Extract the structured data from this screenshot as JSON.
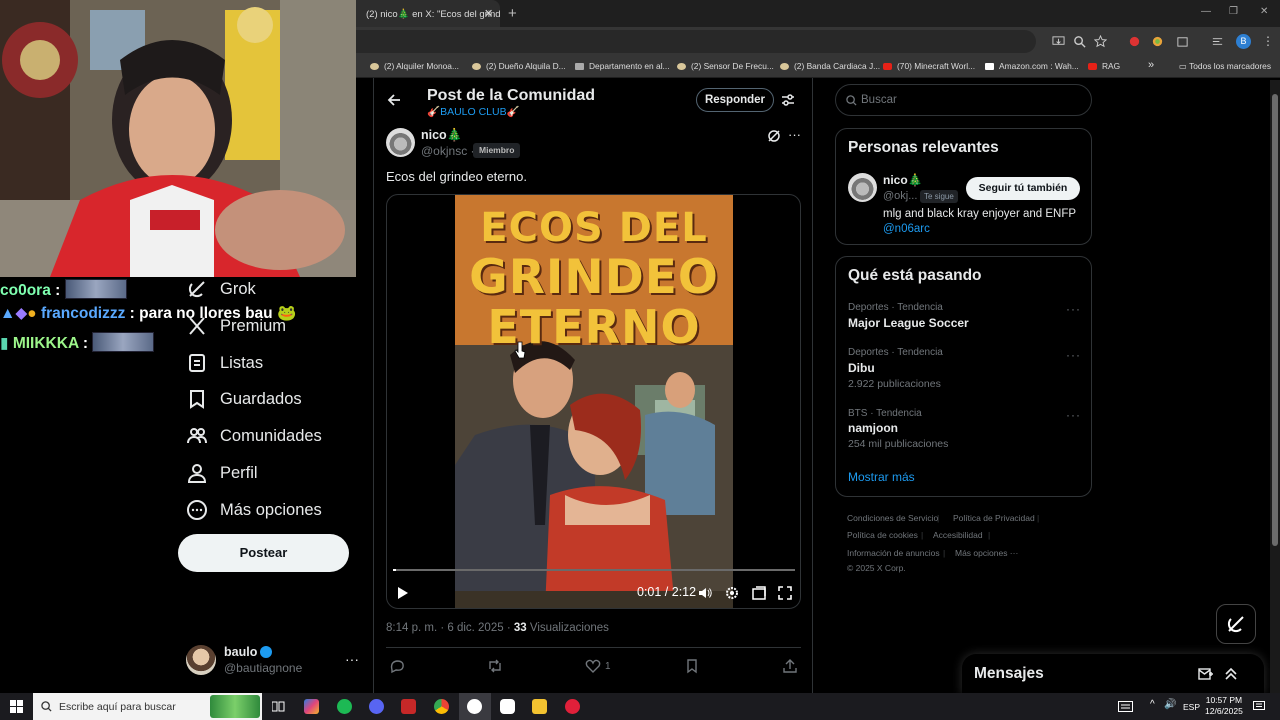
{
  "browser": {
    "tab_title": "(2) nico🎄 en X: \"Ecos del grind",
    "bookmarks": [
      {
        "label": "(2) Alquiler Monoa...",
        "icon": "olx-icon"
      },
      {
        "label": "(2) Dueño Alquila D...",
        "icon": "olx-icon"
      },
      {
        "label": "Departamento en al...",
        "icon": "page-icon"
      },
      {
        "label": "(2) Sensor De Frecu...",
        "icon": "olx-icon"
      },
      {
        "label": "(2) Banda Cardiaca J...",
        "icon": "olx-icon"
      },
      {
        "label": "(70) Minecraft Worl...",
        "icon": "youtube-icon"
      },
      {
        "label": "Amazon.com : Wah...",
        "icon": "amazon-icon"
      },
      {
        "label": "RAG",
        "icon": "youtube-icon"
      }
    ],
    "bookmarks_folder": "Todos los marcadores",
    "profile_initial": "B"
  },
  "stream_chat": [
    {
      "user": "co0ora",
      "text": ":"
    },
    {
      "user": "francodizzz",
      "text": ": para no llores bau"
    },
    {
      "user": "MIIKKKA",
      "text": ":"
    }
  ],
  "nav": {
    "items": [
      {
        "label": "Grok",
        "icon": "grok-icon"
      },
      {
        "label": "Premium",
        "icon": "x-logo-icon"
      },
      {
        "label": "Listas",
        "icon": "list-icon"
      },
      {
        "label": "Guardados",
        "icon": "bookmark-icon"
      },
      {
        "label": "Comunidades",
        "icon": "communities-icon"
      },
      {
        "label": "Perfil",
        "icon": "profile-icon"
      },
      {
        "label": "Más opciones",
        "icon": "more-circle-icon"
      }
    ],
    "post_button": "Postear",
    "account": {
      "name": "baulo",
      "handle": "@bautiagnone"
    }
  },
  "post": {
    "header_title": "Post de la Comunidad",
    "community": "🎸BAULO CLUB🎸",
    "reply_button": "Responder",
    "author_name": "nico🎄",
    "author_handle": "@okjnsc ·",
    "member_badge": "Miembro",
    "text": "Ecos del grindeo eterno.",
    "poster_title_lines": [
      "ECOS DEL",
      "GRINDEO",
      "ETERNO"
    ],
    "video_time": "0:01 / 2:12",
    "video_progress": 0.008,
    "timestamp": "8:14 p. m. · 6 dic. 2025 ·",
    "views_count": "33",
    "views_label": "Visualizaciones",
    "like_count": "1"
  },
  "sidebar": {
    "search_placeholder": "Buscar",
    "relevant_title": "Personas relevantes",
    "relevant_person": {
      "name": "nico🎄",
      "handle": "@okj...",
      "follows_you": "Te sigue",
      "follow_button": "Seguir tú también",
      "bio": "mlg and black kray enjoyer and ENFP",
      "bio_link": "@n06arc"
    },
    "trends_title": "Qué está pasando",
    "trends": [
      {
        "category": "Deportes · Tendencia",
        "name": "Major League Soccer",
        "count": ""
      },
      {
        "category": "Deportes · Tendencia",
        "name": "Dibu",
        "count": "2.922 publicaciones"
      },
      {
        "category": "BTS · Tendencia",
        "name": "namjoon",
        "count": "254 mil publicaciones"
      }
    ],
    "show_more": "Mostrar más",
    "footer": [
      "Condiciones de Servicio",
      "Política de Privacidad",
      "Política de cookies",
      "Accesibilidad",
      "Información de anuncios",
      "Más opciones ···",
      "© 2025 X Corp."
    ],
    "messages_title": "Mensajes"
  },
  "taskbar": {
    "search_placeholder": "Escribe aquí para buscar",
    "language": "ESP",
    "time": "10:57 PM",
    "date": "12/6/2025"
  }
}
